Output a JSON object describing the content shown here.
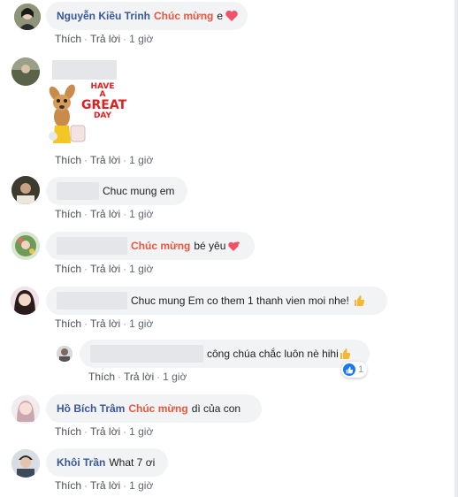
{
  "comments": [
    {
      "name": "Nguyễn Kiều Trinh",
      "highlight": "Chúc mừng",
      "text": "e",
      "time": "1 giờ"
    },
    {
      "name": "",
      "highlight": "",
      "text": "",
      "sticker_text": [
        "HAVE",
        "A",
        "GREAT",
        "DAY"
      ],
      "time": "1 giờ"
    },
    {
      "name": "",
      "highlight": "",
      "text": "Chuc mung em",
      "time": "1 giờ"
    },
    {
      "name": "",
      "highlight": "Chúc mừng",
      "text": "bé yêu",
      "time": "1 giờ"
    },
    {
      "name": "",
      "highlight": "",
      "text": "Chuc mung Em co them 1 thanh vien moi nhe!",
      "time": "1 giờ"
    },
    {
      "name": "",
      "highlight": "",
      "text": "công chúa chắc luôn nè hihi",
      "time": "1 giờ",
      "reactions": "1"
    },
    {
      "name": "Hồ Bích Trâm",
      "highlight": "Chúc mừng",
      "text": "dì của con",
      "time": "1 giờ"
    },
    {
      "name": "Khôi Trần",
      "highlight": "",
      "text": "What 7 ơi",
      "time": "1 giờ"
    }
  ],
  "actions": {
    "like": "Thích",
    "reply": "Trả lời",
    "sep": "·"
  },
  "colors": {
    "name": "#385898",
    "highlight": "#e9573e",
    "bubble": "#f2f3f5",
    "like": "#1877f2",
    "heart": "#f25268"
  },
  "icons": [
    "heart-icon",
    "thumbs-up-icon",
    "like-reaction-icon"
  ]
}
